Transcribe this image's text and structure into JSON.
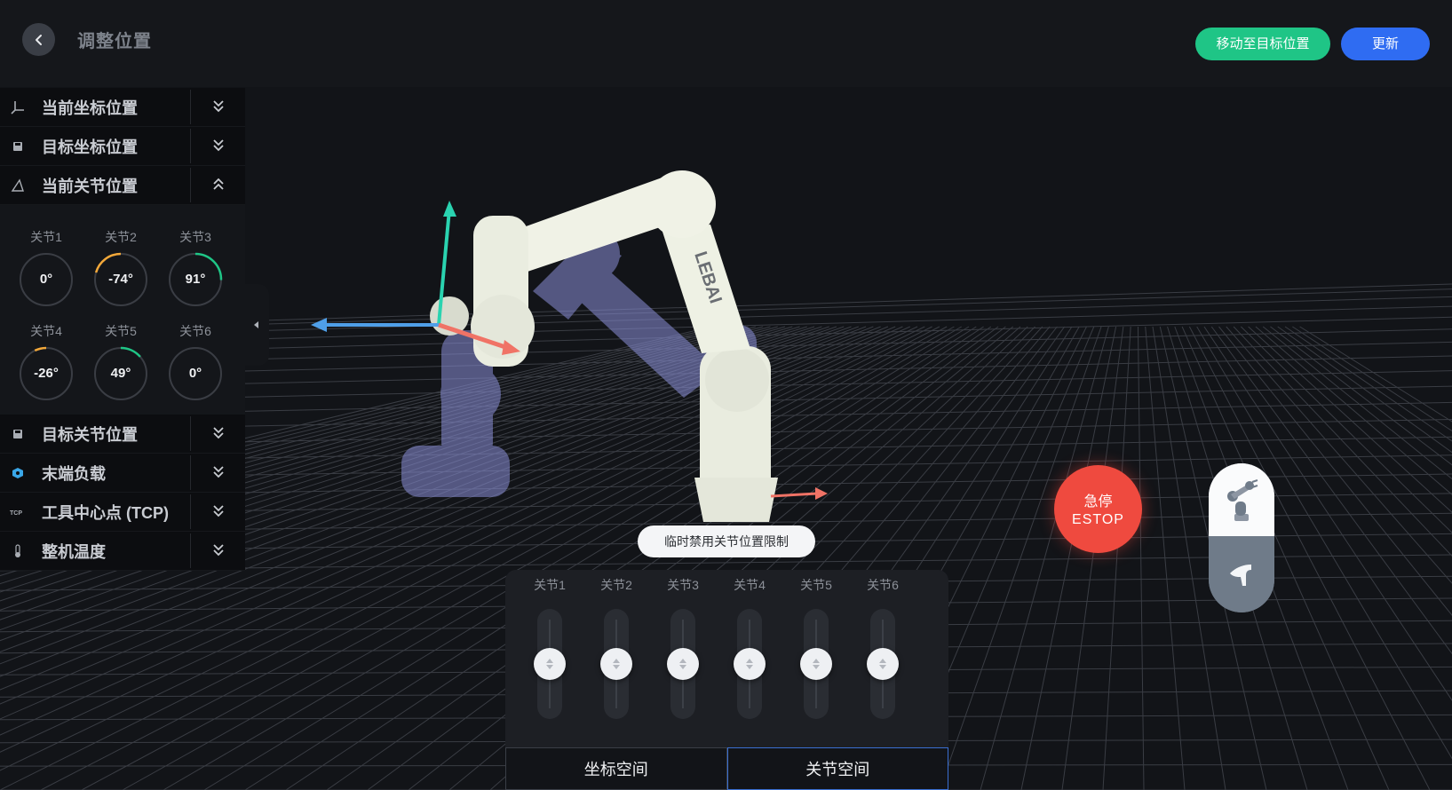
{
  "header": {
    "title": "调整位置",
    "move_button": "移动至目标位置",
    "update_button": "更新"
  },
  "panel": {
    "sections": [
      {
        "label": "当前坐标位置",
        "icon": "axis-icon",
        "expanded": false
      },
      {
        "label": "目标坐标位置",
        "icon": "save-icon",
        "expanded": false
      },
      {
        "label": "当前关节位置",
        "icon": "angle-icon",
        "expanded": true
      },
      {
        "label": "目标关节位置",
        "icon": "save-icon",
        "expanded": false
      },
      {
        "label": "末端负载",
        "icon": "payload-icon",
        "expanded": false
      },
      {
        "label": "工具中心点 (TCP)",
        "icon": "tcp-icon",
        "expanded": false,
        "icon_text": "TCP"
      },
      {
        "label": "整机温度",
        "icon": "thermometer-icon",
        "expanded": false
      }
    ],
    "joints": [
      {
        "label": "关节1",
        "value": "0°",
        "arc_deg": 0,
        "arc_color": ""
      },
      {
        "label": "关节2",
        "value": "-74°",
        "arc_deg": -74,
        "arc_color": "#f2a83a"
      },
      {
        "label": "关节3",
        "value": "91°",
        "arc_deg": 91,
        "arc_color": "#1fc586"
      },
      {
        "label": "关节4",
        "value": "-26°",
        "arc_deg": -26,
        "arc_color": "#f2a83a"
      },
      {
        "label": "关节5",
        "value": "49°",
        "arc_deg": 49,
        "arc_color": "#1fc586"
      },
      {
        "label": "关节6",
        "value": "0°",
        "arc_deg": 0,
        "arc_color": ""
      }
    ]
  },
  "viewport": {
    "robot_brand": "LEBAI"
  },
  "tooltip": "临时禁用关节位置限制",
  "sliders": [
    {
      "label": "关节1"
    },
    {
      "label": "关节2"
    },
    {
      "label": "关节3"
    },
    {
      "label": "关节4"
    },
    {
      "label": "关节5"
    },
    {
      "label": "关节6"
    }
  ],
  "tabs": [
    {
      "label": "坐标空间",
      "active": false
    },
    {
      "label": "关节空间",
      "active": true
    }
  ],
  "estop": {
    "line1": "急停",
    "line2": "ESTOP"
  },
  "colors": {
    "accent_green": "#1fc586",
    "accent_blue": "#2f6cf2",
    "estop_red": "#ef4a3f",
    "warning_orange": "#f2a83a"
  }
}
